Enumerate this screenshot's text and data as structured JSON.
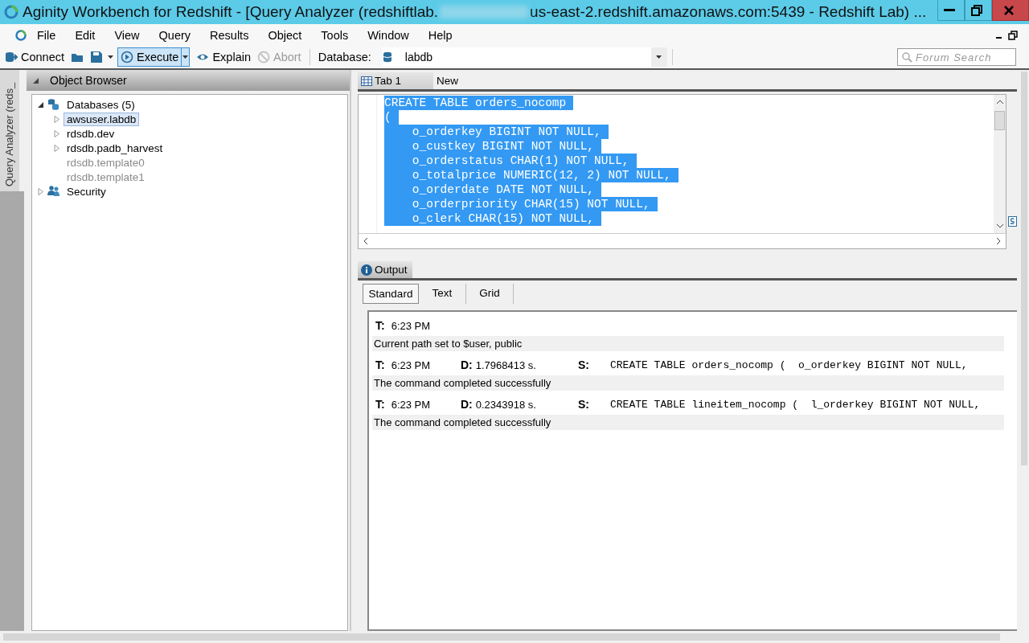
{
  "window": {
    "title_start": "Aginity Workbench for Redshift - [Query Analyzer (redshiftlab.",
    "title_end": "us-east-2.redshift.amazonaws.com:5439 - Redshift Lab) ..."
  },
  "menu": [
    "File",
    "Edit",
    "View",
    "Query",
    "Results",
    "Object",
    "Tools",
    "Window",
    "Help"
  ],
  "toolbar": {
    "buttons": [
      {
        "kind": "connect",
        "label": "Connect",
        "highlighted": false,
        "disabled": false
      },
      {
        "kind": "open",
        "highlighted": false,
        "disabled": false
      },
      {
        "kind": "save",
        "highlighted": false,
        "disabled": false
      },
      {
        "kind": "execute",
        "label": "Execute",
        "highlighted": true,
        "disabled": false
      },
      {
        "kind": "explain",
        "label": "Explain",
        "highlighted": false,
        "disabled": false
      },
      {
        "kind": "abort",
        "label": "Abort",
        "highlighted": false,
        "disabled": true
      }
    ],
    "database_label": "Database:",
    "database": "labdb",
    "search_placeholder": "Forum Search"
  },
  "side_tab": "Query Analyzer (reds_",
  "object_browser": {
    "title": "Object Browser",
    "tree": [
      {
        "kind": "databases",
        "label": "Databases (5)",
        "expanded": true,
        "children": [
          {
            "label": "awsuser.labdb",
            "selected": true,
            "expanded": false,
            "disabled": false
          },
          {
            "label": "rdsdb.dev",
            "selected": false,
            "expanded": false,
            "disabled": false
          },
          {
            "label": "rdsdb.padb_harvest",
            "selected": false,
            "expanded": false,
            "disabled": false
          },
          {
            "label": "rdsdb.template0",
            "selected": false,
            "disabled": true
          },
          {
            "label": "rdsdb.template1",
            "selected": false,
            "disabled": true
          }
        ]
      },
      {
        "kind": "security",
        "label": "Security",
        "expanded": false
      }
    ]
  },
  "editor": {
    "tabs": [
      {
        "label": "Tab 1",
        "selected": true
      },
      {
        "label": "New",
        "selected": false
      }
    ],
    "selected": true,
    "lines": [
      "CREATE TABLE orders_nocomp",
      "(",
      "    o_orderkey BIGINT NOT NULL,",
      "    o_custkey BIGINT NOT NULL,",
      "    o_orderstatus CHAR(1) NOT NULL,",
      "    o_totalprice NUMERIC(12, 2) NOT NULL,",
      "    o_orderdate DATE NOT NULL,",
      "    o_orderpriority CHAR(15) NOT NULL,",
      "    o_clerk CHAR(15) NOT NULL,"
    ]
  },
  "output": {
    "title": "Output",
    "tabs": [
      {
        "label": "Standard",
        "selected": true
      },
      {
        "label": "Text",
        "selected": false
      },
      {
        "label": "Grid",
        "selected": false
      }
    ],
    "entries": [
      {
        "kind": "header",
        "time_label": "T:",
        "time": "6:23 PM"
      },
      {
        "kind": "message",
        "text": "Current path set to $user, public"
      },
      {
        "kind": "header",
        "time_label": "T:",
        "time": "6:23 PM",
        "duration_label": "D:",
        "duration": "1.7968413 s.",
        "statement_label": "S:",
        "statement": "CREATE TABLE orders_nocomp (  o_orderkey BIGINT NOT NULL,"
      },
      {
        "kind": "message",
        "text": "The command completed successfully"
      },
      {
        "kind": "header",
        "time_label": "T:",
        "time": "6:23 PM",
        "duration_label": "D:",
        "duration": "0.2343918 s.",
        "statement_label": "S:",
        "statement": "CREATE TABLE lineitem_nocomp (  l_orderkey BIGINT NOT NULL,"
      },
      {
        "kind": "message",
        "text": "The command completed successfully"
      }
    ]
  }
}
